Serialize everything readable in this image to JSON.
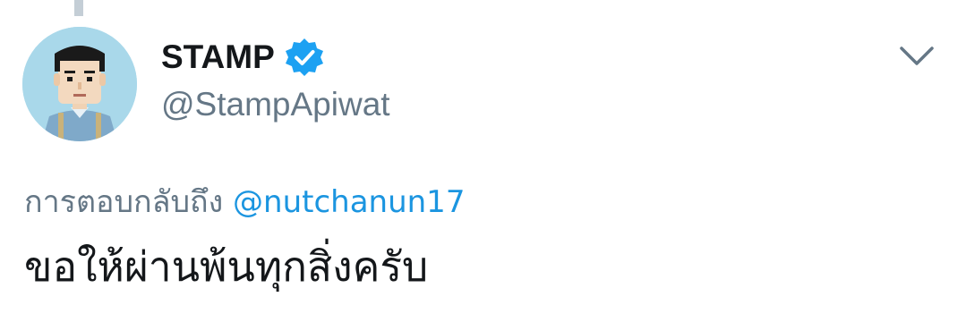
{
  "tweet": {
    "author": {
      "display_name": "STAMP",
      "handle": "@StampApiwat",
      "verified": true,
      "avatar_icon": "cartoon-man-avatar"
    },
    "reply_prefix": "การตอบกลับถึง",
    "reply_to": "@nutchanun17",
    "text": "ขอให้ผ่านพ้นทุกสิ่งครับ",
    "menu_icon": "chevron-down-icon"
  },
  "colors": {
    "text_primary": "#14171a",
    "text_secondary": "#657786",
    "link": "#1b95e0",
    "verified": "#1da1f2",
    "avatar_bg": "#a9d8ea",
    "thread_line": "#c4ced6"
  }
}
